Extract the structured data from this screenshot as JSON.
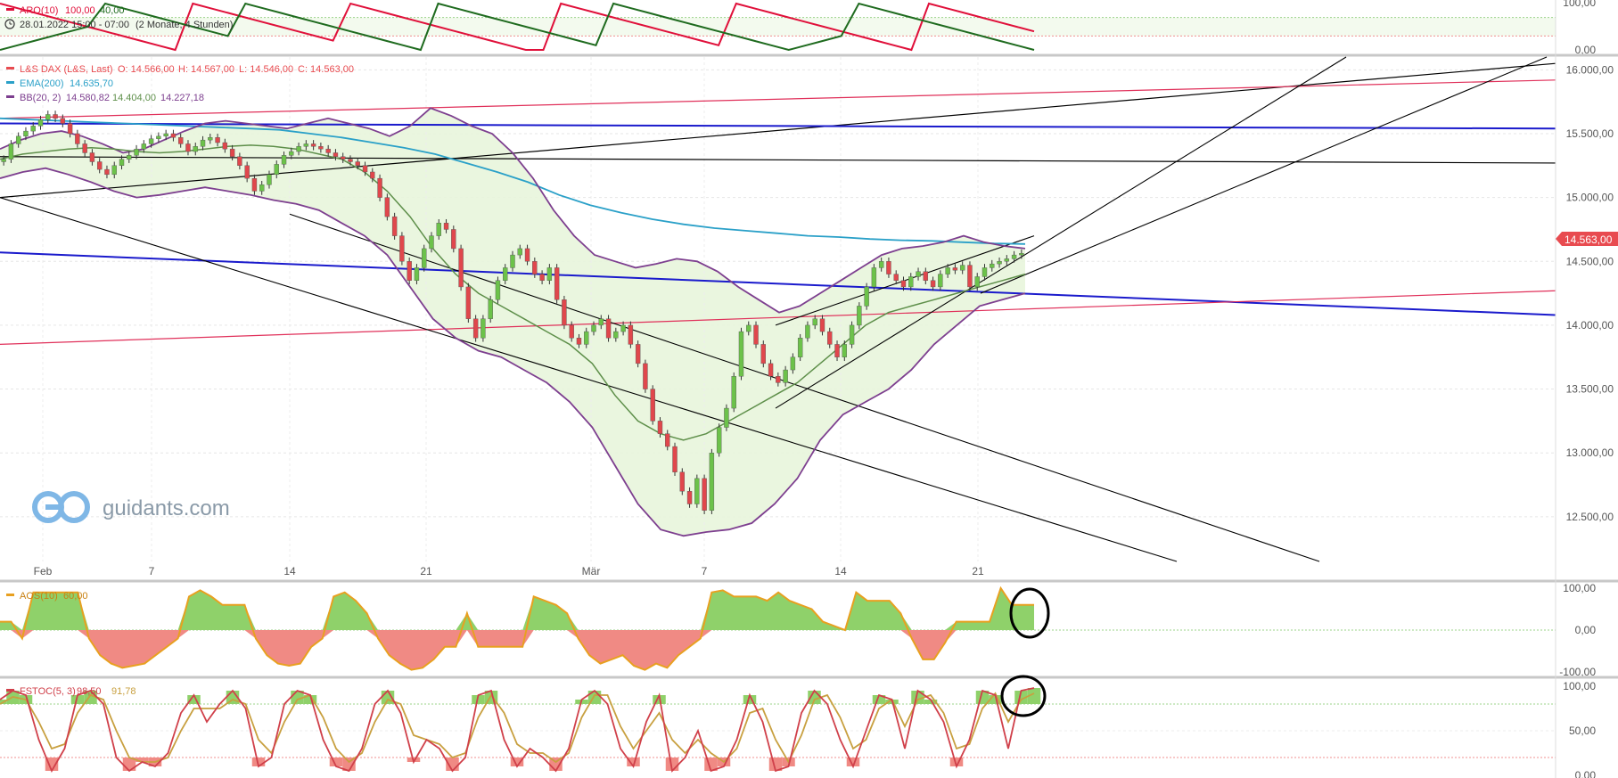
{
  "colors": {
    "bull": "#6cc24a",
    "bear": "#e0474c",
    "ema": "#2aa0c8",
    "bb_outer": "#7d3f8f",
    "bb_mid": "#5e8f4a",
    "bb_fill": "#e8f5dc",
    "aro_up": "#e0103a",
    "aro_down": "#1f6b1f",
    "aos": "#e8a020",
    "aos_pos": "#8fd16a",
    "aos_neg": "#f08a84",
    "fstoc_k": "#d0404a",
    "fstoc_d": "#c8a040",
    "price_tag": "#e84b50",
    "trend_black": "#000000",
    "trend_blue": "#1a1acc",
    "trend_red": "#e0305a"
  },
  "top_panel": {
    "legend_name": "ARO(10)",
    "legend_v1": "100,00",
    "legend_v2": "40,00",
    "period_icon": "clock-icon",
    "period": "28.01.2022 15:00 - 07:00",
    "range": "(2 Monate, 4 Stunden)",
    "axis": [
      "100,00",
      "0,00"
    ]
  },
  "main_panel": {
    "legend1_name": "L&S DAX (L&S, Last)",
    "legend1_o": "O: 14.566,00",
    "legend1_h": "H: 14.567,00",
    "legend1_l": "L: 14.546,00",
    "legend1_c": "C: 14.563,00",
    "legend2_name": "EMA(200)",
    "legend2_v": "14.635,70",
    "legend3_name": "BB(20, 2)",
    "legend3_v1": "14.580,82",
    "legend3_v2": "14.404,00",
    "legend3_v3": "14.227,18",
    "price_tag": "14.563,00",
    "watermark": "guidants.com",
    "logo_icon": "guidants-logo-icon"
  },
  "aos_panel": {
    "legend_name": "AOS(10)",
    "legend_v": "60,00",
    "axis": [
      "100,00",
      "0,00",
      "-100,00"
    ]
  },
  "fstoc_panel": {
    "legend_name": "FSTOC(5, 3)",
    "legend_v1": "98,50",
    "legend_v2": "91,78",
    "axis": [
      "100,00",
      "50,00",
      "0,00"
    ]
  },
  "chart_data": [
    {
      "type": "candlestick",
      "title": "L&S DAX (L&S, Last)",
      "x_tick_labels": [
        "Feb",
        "7",
        "14",
        "21",
        "Mär",
        "7",
        "14",
        "21"
      ],
      "y_tick_labels": [
        "16.000,00",
        "15.500,00",
        "15.000,00",
        "14.500,00",
        "14.000,00",
        "13.500,00",
        "13.000,00",
        "12.500,00"
      ],
      "ylim": [
        12150,
        16100
      ],
      "close_series": [
        15300,
        15420,
        15480,
        15520,
        15560,
        15610,
        15650,
        15620,
        15580,
        15500,
        15420,
        15350,
        15280,
        15220,
        15180,
        15250,
        15300,
        15330,
        15380,
        15420,
        15460,
        15480,
        15500,
        15470,
        15420,
        15360,
        15400,
        15450,
        15470,
        15430,
        15380,
        15320,
        15250,
        15150,
        15050,
        15100,
        15180,
        15260,
        15330,
        15360,
        15400,
        15420,
        15400,
        15380,
        15350,
        15320,
        15300,
        15280,
        15250,
        15200,
        15150,
        15000,
        14850,
        14700,
        14500,
        14350,
        14450,
        14600,
        14700,
        14800,
        14750,
        14600,
        14300,
        14050,
        13900,
        14050,
        14200,
        14350,
        14450,
        14550,
        14600,
        14500,
        14400,
        14350,
        14450,
        14200,
        14000,
        13900,
        13850,
        13950,
        14000,
        14050,
        13900,
        13950,
        14000,
        13850,
        13700,
        13500,
        13250,
        13150,
        13050,
        12850,
        12700,
        12600,
        12800,
        12550,
        13000,
        13200,
        13350,
        13600,
        13950,
        14000,
        13850,
        13700,
        13600,
        13550,
        13650,
        13750,
        13900,
        14000,
        14050,
        13950,
        13850,
        13750,
        13850,
        14000,
        14150,
        14300,
        14450,
        14500,
        14400,
        14350,
        14300,
        14380,
        14420,
        14350,
        14300,
        14400,
        14450,
        14430,
        14470,
        14300,
        14380,
        14450,
        14480,
        14500,
        14520,
        14550,
        14563
      ],
      "ema200": [
        15620,
        15610,
        15600,
        15590,
        15580,
        15570,
        15560,
        15550,
        15540,
        15530,
        15500,
        15470,
        15430,
        15390,
        15340,
        15270,
        15200,
        15120,
        15020,
        14940,
        14880,
        14830,
        14790,
        14760,
        14740,
        14720,
        14700,
        14690,
        14675,
        14665,
        14660,
        14650,
        14640,
        14636
      ],
      "bb_upper": [
        15380,
        15450,
        15500,
        15520,
        15480,
        15420,
        15350,
        15380,
        15450,
        15520,
        15580,
        15600,
        15580,
        15560,
        15540,
        15580,
        15620,
        15580,
        15540,
        15480,
        15560,
        15700,
        15640,
        15560,
        15500,
        15350,
        15150,
        14900,
        14700,
        14550,
        14500,
        14450,
        14480,
        14520,
        14500,
        14420,
        14300,
        14200,
        14100,
        14150,
        14250,
        14350,
        14450,
        14550,
        14600,
        14620,
        14650,
        14700,
        14650,
        14620,
        14600
      ],
      "bb_middle": [
        15300,
        15340,
        15360,
        15380,
        15390,
        15380,
        15360,
        15350,
        15360,
        15380,
        15400,
        15410,
        15400,
        15380,
        15340,
        15300,
        15200,
        15050,
        14850,
        14600,
        14400,
        14250,
        14150,
        14050,
        13950,
        13850,
        13700,
        13450,
        13250,
        13150,
        13100,
        13150,
        13250,
        13350,
        13450,
        13550,
        13700,
        13850,
        14000,
        14100,
        14150,
        14200,
        14250,
        14300,
        14350,
        14400
      ],
      "bb_lower": [
        15150,
        15200,
        15230,
        15180,
        15120,
        15050,
        15000,
        15020,
        15050,
        15080,
        15050,
        15020,
        14980,
        14950,
        14900,
        14800,
        14700,
        14550,
        14300,
        14050,
        13900,
        13800,
        13750,
        13650,
        13550,
        13400,
        13200,
        12900,
        12600,
        12400,
        12350,
        12380,
        12400,
        12450,
        12600,
        12800,
        13100,
        13300,
        13400,
        13500,
        13650,
        13850,
        14000,
        14150,
        14200,
        14250
      ],
      "trendlines": [
        {
          "color": "black",
          "from": [
            0,
            15000
          ],
          "to": [
            1,
            16050
          ]
        },
        {
          "color": "black",
          "from": [
            0,
            15320
          ],
          "to": [
            1,
            15270
          ]
        },
        {
          "color": "blue",
          "from": [
            0,
            15580
          ],
          "to": [
            1,
            15540
          ]
        },
        {
          "color": "blue",
          "from": [
            0,
            14570
          ],
          "to": [
            1,
            14080
          ]
        },
        {
          "color": "red",
          "from": [
            0,
            13850
          ],
          "to": [
            1,
            14270
          ]
        },
        {
          "color": "red",
          "from": [
            0,
            15620
          ],
          "to": [
            1,
            15920
          ]
        }
      ]
    },
    {
      "type": "line",
      "title": "ARO(10)",
      "ylim": [
        0,
        100
      ],
      "series": [
        {
          "name": "up",
          "values": [
            100,
            90,
            80,
            70,
            60,
            50,
            40,
            30,
            20,
            10,
            0,
            100,
            90,
            80,
            70,
            60,
            50,
            40,
            30,
            20,
            100,
            90,
            80,
            70,
            60,
            50,
            40,
            30,
            20,
            10,
            0,
            0,
            100,
            90,
            80,
            70,
            60,
            50,
            40,
            30,
            20,
            10,
            100,
            90,
            80,
            70,
            60,
            50,
            40,
            30,
            20,
            10,
            0,
            100,
            90,
            80,
            70,
            60,
            50,
            40
          ]
        },
        {
          "name": "down",
          "values": [
            0,
            10,
            20,
            30,
            40,
            50,
            100,
            90,
            80,
            70,
            60,
            50,
            40,
            30,
            100,
            90,
            80,
            70,
            60,
            50,
            40,
            30,
            20,
            10,
            0,
            100,
            90,
            80,
            70,
            60,
            50,
            40,
            30,
            20,
            10,
            100,
            90,
            80,
            70,
            60,
            50,
            40,
            30,
            20,
            10,
            0,
            10,
            20,
            30,
            100,
            90,
            80,
            70,
            60,
            50,
            40,
            30,
            20,
            10,
            0
          ]
        }
      ]
    },
    {
      "type": "area",
      "title": "AOS(10)",
      "ylim": [
        -100,
        100
      ],
      "values": [
        20,
        20,
        -20,
        90,
        90,
        90,
        90,
        90,
        -20,
        -60,
        -80,
        -90,
        -85,
        -80,
        -60,
        -40,
        -20,
        80,
        95,
        80,
        60,
        60,
        60,
        -20,
        -60,
        -80,
        -85,
        -80,
        -40,
        -20,
        80,
        90,
        70,
        40,
        -20,
        -60,
        -80,
        -95,
        -90,
        -70,
        -40,
        -40,
        40,
        -40,
        -40,
        -40,
        -40,
        -40,
        80,
        70,
        60,
        40,
        -20,
        -60,
        -80,
        -70,
        -60,
        -85,
        -95,
        -80,
        -90,
        -60,
        -40,
        -20,
        90,
        95,
        80,
        80,
        80,
        70,
        90,
        70,
        60,
        50,
        20,
        10,
        0,
        90,
        70,
        70,
        70,
        40,
        -20,
        -70,
        -70,
        -30,
        20,
        20,
        20,
        20,
        100,
        60,
        60,
        60
      ]
    },
    {
      "type": "line",
      "title": "FSTOC(5, 3)",
      "ylim": [
        0,
        100
      ],
      "series": [
        {
          "name": "%K",
          "values": [
            85,
            95,
            90,
            40,
            5,
            30,
            90,
            95,
            80,
            20,
            5,
            15,
            10,
            25,
            70,
            90,
            60,
            80,
            95,
            75,
            10,
            20,
            80,
            95,
            90,
            40,
            10,
            5,
            30,
            80,
            95,
            70,
            15,
            40,
            30,
            5,
            20,
            90,
            95,
            40,
            10,
            30,
            20,
            5,
            30,
            85,
            95,
            80,
            30,
            10,
            60,
            90,
            5,
            20,
            50,
            5,
            10,
            40,
            90,
            60,
            5,
            10,
            70,
            95,
            80,
            40,
            10,
            50,
            90,
            85,
            30,
            95,
            85,
            60,
            10,
            40,
            95,
            90,
            30,
            95,
            98
          ]
        },
        {
          "name": "%D",
          "values": [
            80,
            88,
            85,
            60,
            30,
            35,
            70,
            90,
            85,
            50,
            20,
            15,
            15,
            20,
            50,
            75,
            75,
            75,
            85,
            80,
            40,
            25,
            60,
            85,
            90,
            65,
            30,
            15,
            25,
            60,
            85,
            80,
            45,
            40,
            35,
            20,
            25,
            65,
            90,
            70,
            35,
            25,
            25,
            15,
            25,
            65,
            90,
            90,
            55,
            30,
            50,
            70,
            40,
            25,
            40,
            25,
            15,
            30,
            70,
            75,
            40,
            15,
            45,
            85,
            90,
            65,
            30,
            40,
            75,
            85,
            55,
            85,
            90,
            70,
            30,
            35,
            75,
            92,
            60,
            85,
            92
          ]
        }
      ]
    }
  ]
}
